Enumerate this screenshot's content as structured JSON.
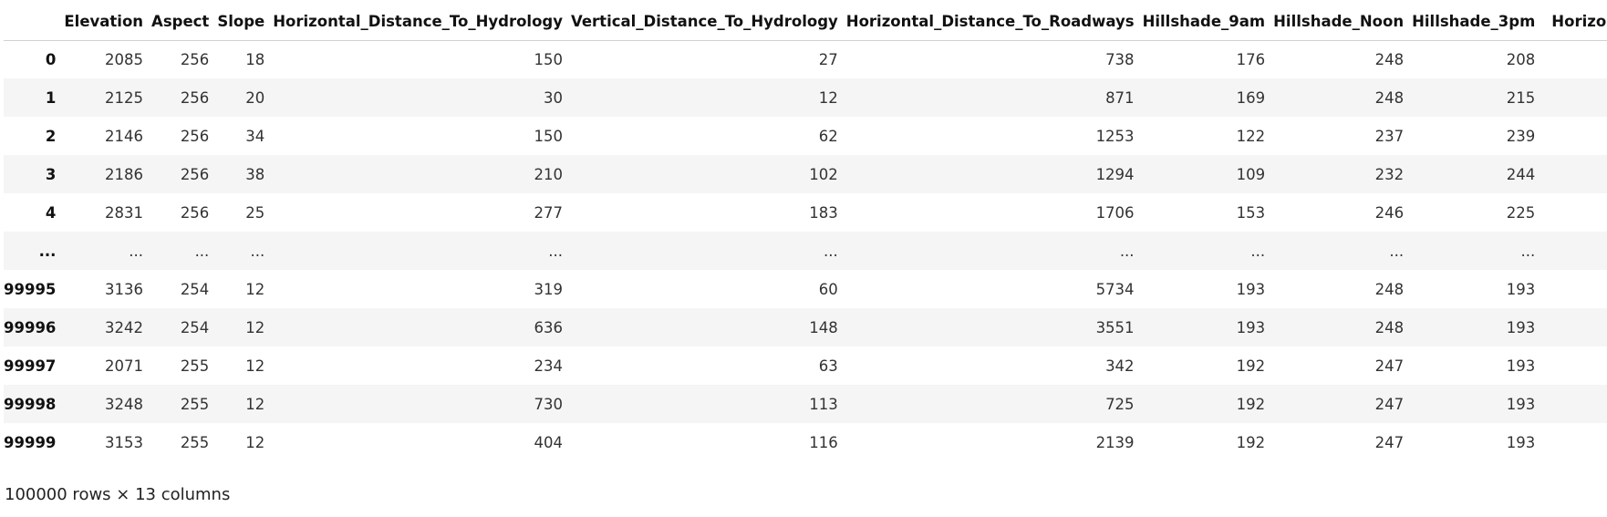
{
  "table": {
    "columns": [
      "",
      "Elevation",
      "Aspect",
      "Slope",
      "Horizontal_Distance_To_Hydrology",
      "Vertical_Distance_To_Hydrology",
      "Horizontal_Distance_To_Roadways",
      "Hillshade_9am",
      "Hillshade_Noon",
      "Hillshade_3pm",
      "Horizontal_"
    ],
    "rows": [
      [
        "0",
        "2085",
        "256",
        "18",
        "150",
        "27",
        "738",
        "176",
        "248",
        "208",
        ""
      ],
      [
        "1",
        "2125",
        "256",
        "20",
        "30",
        "12",
        "871",
        "169",
        "248",
        "215",
        ""
      ],
      [
        "2",
        "2146",
        "256",
        "34",
        "150",
        "62",
        "1253",
        "122",
        "237",
        "239",
        ""
      ],
      [
        "3",
        "2186",
        "256",
        "38",
        "210",
        "102",
        "1294",
        "109",
        "232",
        "244",
        ""
      ],
      [
        "4",
        "2831",
        "256",
        "25",
        "277",
        "183",
        "1706",
        "153",
        "246",
        "225",
        ""
      ],
      [
        "...",
        "...",
        "...",
        "...",
        "...",
        "...",
        "...",
        "...",
        "...",
        "...",
        ""
      ],
      [
        "99995",
        "3136",
        "254",
        "12",
        "319",
        "60",
        "5734",
        "193",
        "248",
        "193",
        ""
      ],
      [
        "99996",
        "3242",
        "254",
        "12",
        "636",
        "148",
        "3551",
        "193",
        "248",
        "193",
        ""
      ],
      [
        "99997",
        "2071",
        "255",
        "12",
        "234",
        "63",
        "342",
        "192",
        "247",
        "193",
        ""
      ],
      [
        "99998",
        "3248",
        "255",
        "12",
        "730",
        "113",
        "725",
        "192",
        "247",
        "193",
        ""
      ],
      [
        "99999",
        "3153",
        "255",
        "12",
        "404",
        "116",
        "2139",
        "192",
        "247",
        "193",
        ""
      ]
    ]
  },
  "shape_text": "100000 rows × 13 columns"
}
